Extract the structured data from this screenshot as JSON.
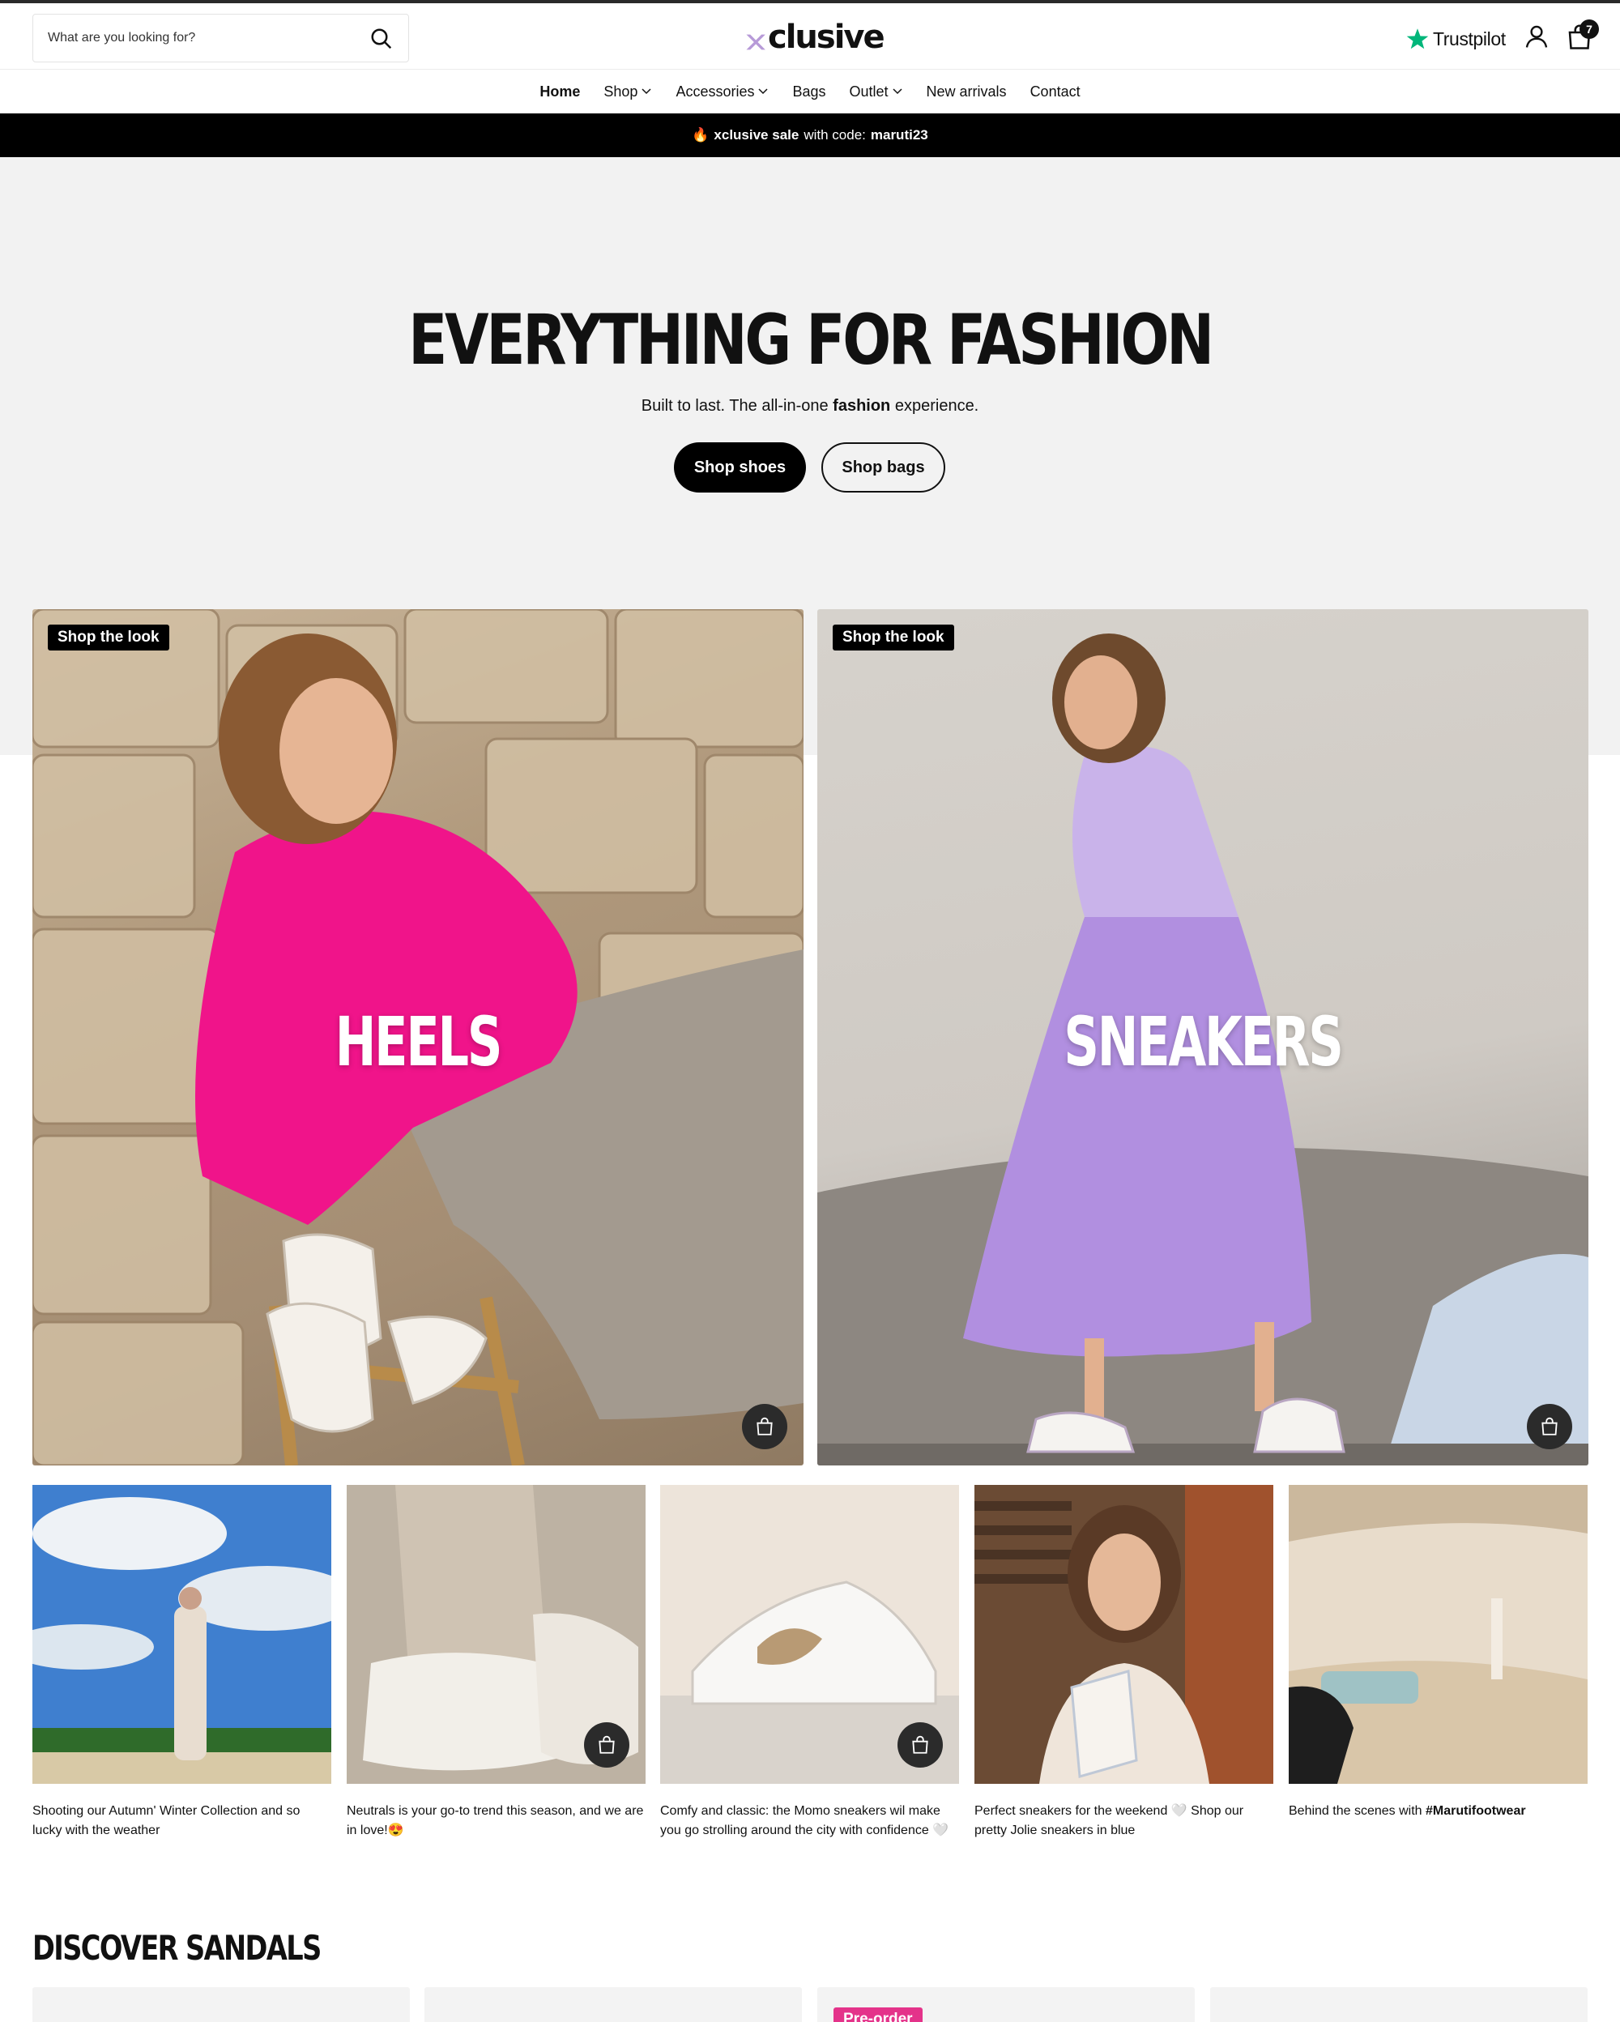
{
  "header": {
    "search_placeholder": "What are you looking for?",
    "logo_text": "clusive",
    "trustpilot_label": "Trustpilot",
    "cart_count": "7"
  },
  "nav": {
    "items": [
      {
        "label": "Home",
        "active": true,
        "dropdown": false
      },
      {
        "label": "Shop",
        "active": false,
        "dropdown": true
      },
      {
        "label": "Accessories",
        "active": false,
        "dropdown": true
      },
      {
        "label": "Bags",
        "active": false,
        "dropdown": false
      },
      {
        "label": "Outlet",
        "active": false,
        "dropdown": true
      },
      {
        "label": "New arrivals",
        "active": false,
        "dropdown": false
      },
      {
        "label": "Contact",
        "active": false,
        "dropdown": false
      }
    ]
  },
  "promo": {
    "icon": "fire-icon",
    "bold_text": "xclusive sale",
    "text": "with code:",
    "code": "maruti23"
  },
  "hero": {
    "title": "EVERYTHING FOR FASHION",
    "subtitle_pre": "Built to last. The all-in-one",
    "subtitle_bold": "fashion",
    "subtitle_post": "experience.",
    "primary_button": "Shop shoes",
    "secondary_button": "Shop bags"
  },
  "looks": [
    {
      "tag": "Shop the look",
      "label": "HEELS"
    },
    {
      "tag": "Shop the look",
      "label": "SNEAKERS"
    }
  ],
  "instagram": [
    {
      "caption": "Shooting our Autumn' Winter Collection and so lucky with the weather",
      "has_bag": false
    },
    {
      "caption": "Neutrals is your go-to trend this season, and we are in love!😍",
      "has_bag": true
    },
    {
      "caption": "Comfy and classic: the Momo sneakers wil make you go strolling around the city with confidence 🤍",
      "has_bag": true
    },
    {
      "caption": "Perfect sneakers for the weekend 🤍 Shop our pretty Jolie sneakers in blue",
      "has_bag": false
    },
    {
      "caption_pre": "Behind the scenes with",
      "caption_bold": "#Marutifootwear",
      "has_bag": false
    }
  ],
  "sandals": {
    "title": "DISCOVER SANDALS",
    "badge": "Pre-order"
  },
  "colors": {
    "accent_purple": "#b79ad8",
    "trustpilot_green": "#00b67a",
    "preorder_pink": "#e4338a",
    "black": "#000000",
    "hero_bg": "#f2f2f2"
  }
}
